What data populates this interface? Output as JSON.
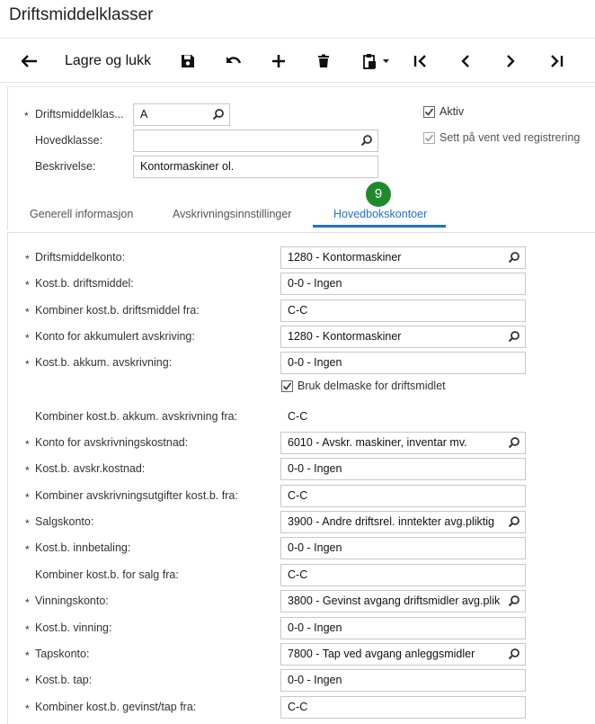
{
  "window": {
    "title": "Driftsmiddelklasser"
  },
  "toolbar": {
    "save_close_label": "Lagre og lukk",
    "icons": [
      "back-arrow-icon",
      "save-icon",
      "undo-icon",
      "add-icon",
      "delete-icon",
      "paste-icon",
      "first-record-icon",
      "previous-record-icon",
      "next-record-icon",
      "last-record-icon"
    ]
  },
  "header": {
    "class_label": "Driftsmiddelklas...",
    "class_value": "A",
    "main_class_label": "Hovedklasse:",
    "main_class_value": "",
    "description_label": "Beskrivelse:",
    "description_value": "Kontormaskiner ol.",
    "active_label": "Aktiv",
    "active_checked": true,
    "hold_label": "Sett på vent ved registrering",
    "hold_checked": true
  },
  "tabs": [
    {
      "label": "Generell informasjon",
      "active": false
    },
    {
      "label": "Avskrivningsinnstillinger",
      "active": false
    },
    {
      "label": "Hovedbokskontoer",
      "active": true
    }
  ],
  "badge": {
    "number": "9",
    "color": "#1f8a2c"
  },
  "accent_color": "#1f73c9",
  "form": {
    "rows": [
      {
        "label": "Driftsmiddelkonto:",
        "value": "1280 - Kontormaskiner",
        "required": true,
        "lookup": true
      },
      {
        "label": "Kost.b. driftsmiddel:",
        "value": "0-0 - Ingen",
        "required": true,
        "lookup": false
      },
      {
        "label": "Kombiner kost.b. driftsmiddel fra:",
        "value": "C-C",
        "required": true,
        "lookup": false
      },
      {
        "label": "Konto for akkumulert avskriving:",
        "value": "1280 - Kontormaskiner",
        "required": true,
        "lookup": true
      },
      {
        "label": "Kost.b. akkum. avskrivning:",
        "value": "0-0 - Ingen",
        "required": true,
        "lookup": false
      },
      {
        "label": "Kombiner kost.b. akkum. avskrivning fra:",
        "value": "C-C",
        "required": false,
        "lookup": false
      },
      {
        "label": "Konto for avskrivningskostnad:",
        "value": "6010 - Avskr. maskiner, inventar mv.",
        "required": true,
        "lookup": true
      },
      {
        "label": "Kost.b. avskr.kostnad:",
        "value": "0-0 - Ingen",
        "required": true,
        "lookup": false
      },
      {
        "label": "Kombiner avskrivningsutgifter kost.b. fra:",
        "value": "C-C",
        "required": true,
        "lookup": false
      },
      {
        "label": "Salgskonto:",
        "value": "3900 - Andre driftsrel. inntekter avg.pliktig",
        "required": true,
        "lookup": true
      },
      {
        "label": "Kost.b. innbetaling:",
        "value": "0-0 - Ingen",
        "required": true,
        "lookup": false
      },
      {
        "label": "Kombiner kost.b. for salg fra:",
        "value": "C-C",
        "required": false,
        "lookup": false
      },
      {
        "label": "Vinningskonto:",
        "value": "3800 - Gevinst avgang driftsmidler avg.plik",
        "required": true,
        "lookup": true
      },
      {
        "label": "Kost.b. vinning:",
        "value": "0-0 - Ingen",
        "required": true,
        "lookup": false
      },
      {
        "label": "Tapskonto:",
        "value": "7800 - Tap ved avgang anleggsmidler",
        "required": true,
        "lookup": true
      },
      {
        "label": "Kost.b. tap:",
        "value": "0-0 - Ingen",
        "required": true,
        "lookup": false
      },
      {
        "label": "Kombiner kost.b. gevinst/tap fra:",
        "value": "C-C",
        "required": true,
        "lookup": false
      }
    ],
    "submask_label": "Bruk delmaske for driftsmidlet",
    "submask_checked": true
  }
}
